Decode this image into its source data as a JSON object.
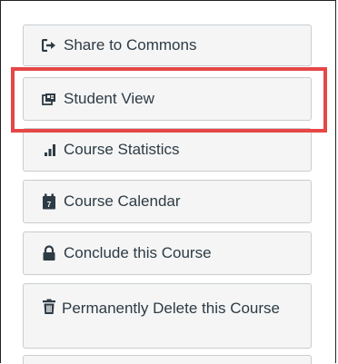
{
  "sidebar": {
    "buttons": [
      {
        "label": "Share to Commons",
        "icon": "share-icon"
      },
      {
        "label": "Student View",
        "icon": "student-view-icon"
      },
      {
        "label": "Course Statistics",
        "icon": "bar-chart-icon"
      },
      {
        "label": "Course Calendar",
        "icon": "calendar-icon"
      },
      {
        "label": "Conclude this Course",
        "icon": "lock-icon"
      },
      {
        "label": "Permanently Delete this Course",
        "icon": "trash-icon"
      }
    ]
  },
  "colors": {
    "highlight": "#e64646",
    "button_bg": "#f5f5f5",
    "button_border": "#c7cdd1",
    "text": "#2d3b45"
  }
}
